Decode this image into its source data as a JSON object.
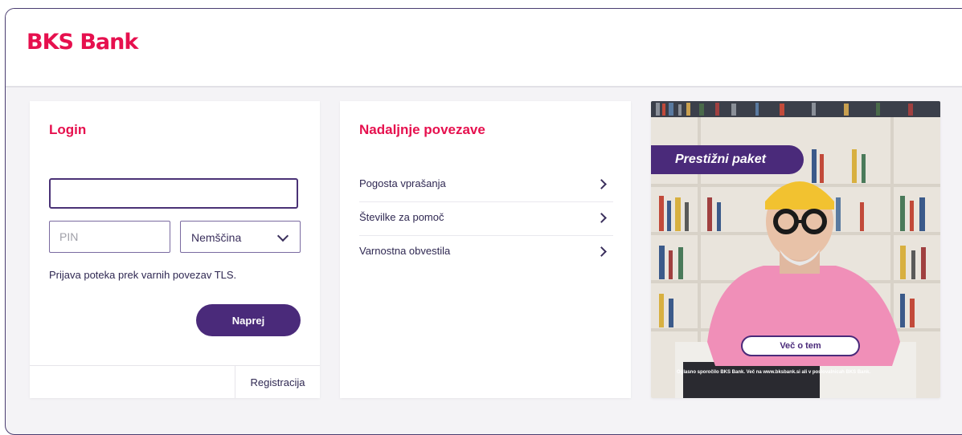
{
  "header": {
    "logo": "BKS Bank"
  },
  "login": {
    "title": "Login",
    "username_value": "",
    "pin_placeholder": "PIN",
    "language_selected": "Nemščina",
    "tls_note": "Prijava poteka prek varnih povezav TLS.",
    "submit_label": "Naprej",
    "register_label": "Registracija"
  },
  "links": {
    "title": "Nadaljnje povezave",
    "items": [
      {
        "label": "Pogosta vprašanja"
      },
      {
        "label": "Številke za pomoč"
      },
      {
        "label": "Varnostna obvestila"
      }
    ]
  },
  "promo": {
    "badge": "Prestižni paket",
    "button_label": "Več o tem",
    "fine_print": "Oglasno sporočilo BKS Bank. Več na www.bksbank.si ali v poslovalnicah BKS Bank."
  },
  "colors": {
    "brand_red": "#e6104e",
    "brand_purple": "#4a2a7a"
  }
}
